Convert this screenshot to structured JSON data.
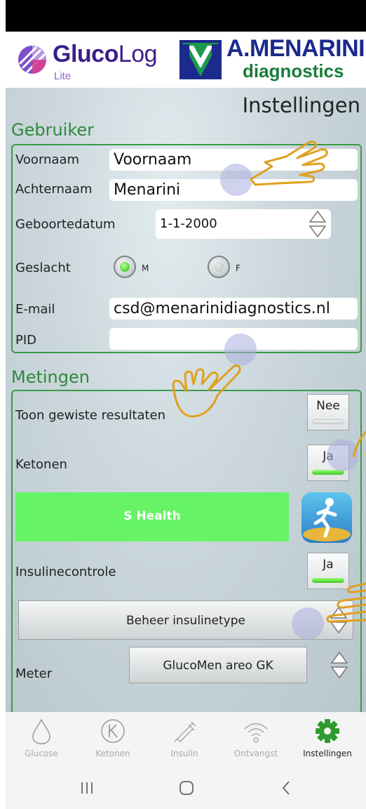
{
  "header": {
    "app_name_bold": "Gluco",
    "app_name_light": "Log",
    "app_edition": "Lite",
    "brand_name": "A.MENARINI",
    "brand_sub": "diagnostics"
  },
  "page_title": "Instellingen",
  "user_section": {
    "title": "Gebruiker",
    "first_name_label": "Voornaam",
    "first_name_value": "Voornaam",
    "last_name_label": "Achternaam",
    "last_name_value": "Menarini",
    "birthdate_label": "Geboortedatum",
    "birthdate_value": "1-1-2000",
    "gender_label": "Geslacht",
    "gender_male": "M",
    "gender_female": "F",
    "gender_selected": "M",
    "email_label": "E-mail",
    "email_value": "csd@menarinidiagnostics.nl",
    "pid_label": "PID",
    "pid_value": ""
  },
  "measurements_section": {
    "title": "Metingen",
    "show_deleted_label": "Toon gewiste resultaten",
    "show_deleted_value": "Nee",
    "ketones_label": "Ketonen",
    "ketones_value": "Ja",
    "shealth_label": "S Health",
    "insulin_check_label": "Insulinecontrole",
    "insulin_check_value": "Ja",
    "manage_insulin_button": "Beheer insulinetype",
    "meter_label": "Meter",
    "meter_value": "GlucoMen areo GK"
  },
  "tabs": [
    {
      "label": "Glucose",
      "icon": "drop-icon"
    },
    {
      "label": "Ketonen",
      "icon": "ketone-k-icon"
    },
    {
      "label": "Insulin",
      "icon": "syringe-icon"
    },
    {
      "label": "Ontvangst",
      "icon": "wifi-icon"
    },
    {
      "label": "Instellingen",
      "icon": "gear-icon"
    }
  ],
  "active_tab": "Instellingen",
  "colors": {
    "accent_green": "#3b9a48",
    "shealth_green": "#66f466",
    "brand_blue": "#1b2a8c",
    "gesture_hand": "#e0a020"
  }
}
